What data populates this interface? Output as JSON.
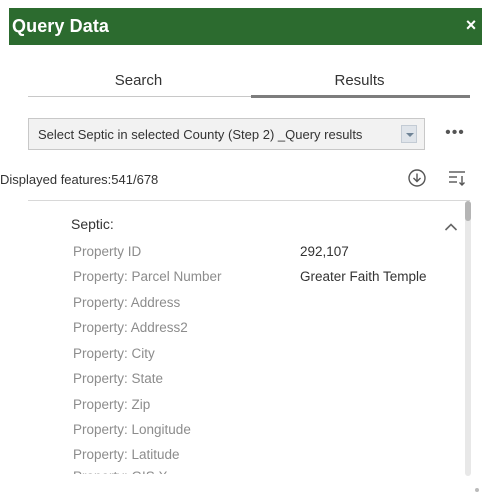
{
  "window": {
    "title": "Query Data",
    "close_glyph": "×"
  },
  "tabs": [
    {
      "label": "Search",
      "active": false
    },
    {
      "label": "Results",
      "active": true
    }
  ],
  "query_select": {
    "value": "Select Septic in selected County (Step 2) _Query results"
  },
  "features": {
    "label": "Displayed features:541/678"
  },
  "result": {
    "layer_title": "Septic:",
    "fields": [
      {
        "key": "Property ID",
        "value": "292,107"
      },
      {
        "key": "Property: Parcel Number",
        "value": "Greater Faith Temple"
      },
      {
        "key": "Property: Address",
        "value": ""
      },
      {
        "key": "Property: Address2",
        "value": ""
      },
      {
        "key": "Property: City",
        "value": ""
      },
      {
        "key": "Property: State",
        "value": ""
      },
      {
        "key": "Property: Zip",
        "value": ""
      },
      {
        "key": "Property: Longitude",
        "value": ""
      },
      {
        "key": "Property: Latitude",
        "value": ""
      },
      {
        "key": "Property: GIS X",
        "value": ""
      }
    ]
  },
  "icons": {
    "close": "close-icon",
    "dropdown": "chevron-down-icon",
    "more": "more-options-icon",
    "download": "download-icon",
    "sort": "sort-icon",
    "collapse": "chevron-up-icon"
  },
  "colors": {
    "header_bg": "#2c6b2f",
    "header_text": "#ffffff",
    "muted_text": "#8c8c8c"
  }
}
